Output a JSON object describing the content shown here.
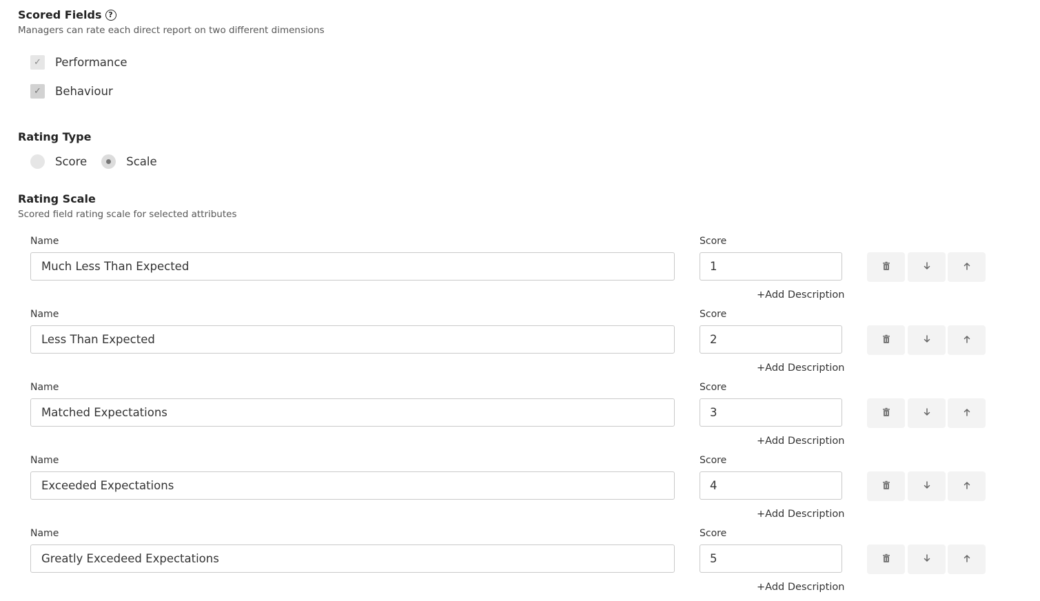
{
  "scored_fields": {
    "title": "Scored Fields",
    "help_glyph": "?",
    "subtitle": "Managers can rate each direct report on two different dimensions",
    "options": [
      {
        "label": "Performance",
        "checked": true
      },
      {
        "label": "Behaviour",
        "checked": true
      }
    ]
  },
  "rating_type": {
    "title": "Rating Type",
    "options": [
      {
        "label": "Score",
        "selected": false
      },
      {
        "label": "Scale",
        "selected": true
      }
    ]
  },
  "rating_scale": {
    "title": "Rating Scale",
    "subtitle": "Scored field rating scale for selected attributes",
    "name_label": "Name",
    "score_label": "Score",
    "add_description_label": "+Add Description",
    "rows": [
      {
        "name": "Much Less Than Expected",
        "score": "1"
      },
      {
        "name": "Less Than Expected",
        "score": "2"
      },
      {
        "name": "Matched Expectations",
        "score": "3"
      },
      {
        "name": "Exceeded Expectations",
        "score": "4"
      },
      {
        "name": "Greatly Excedeed Expectations",
        "score": "5"
      }
    ]
  },
  "icons": {
    "delete": "trash-icon",
    "move_down": "arrow-down-icon",
    "move_up": "arrow-up-icon",
    "check": "check-icon",
    "help": "question-circle-icon"
  }
}
